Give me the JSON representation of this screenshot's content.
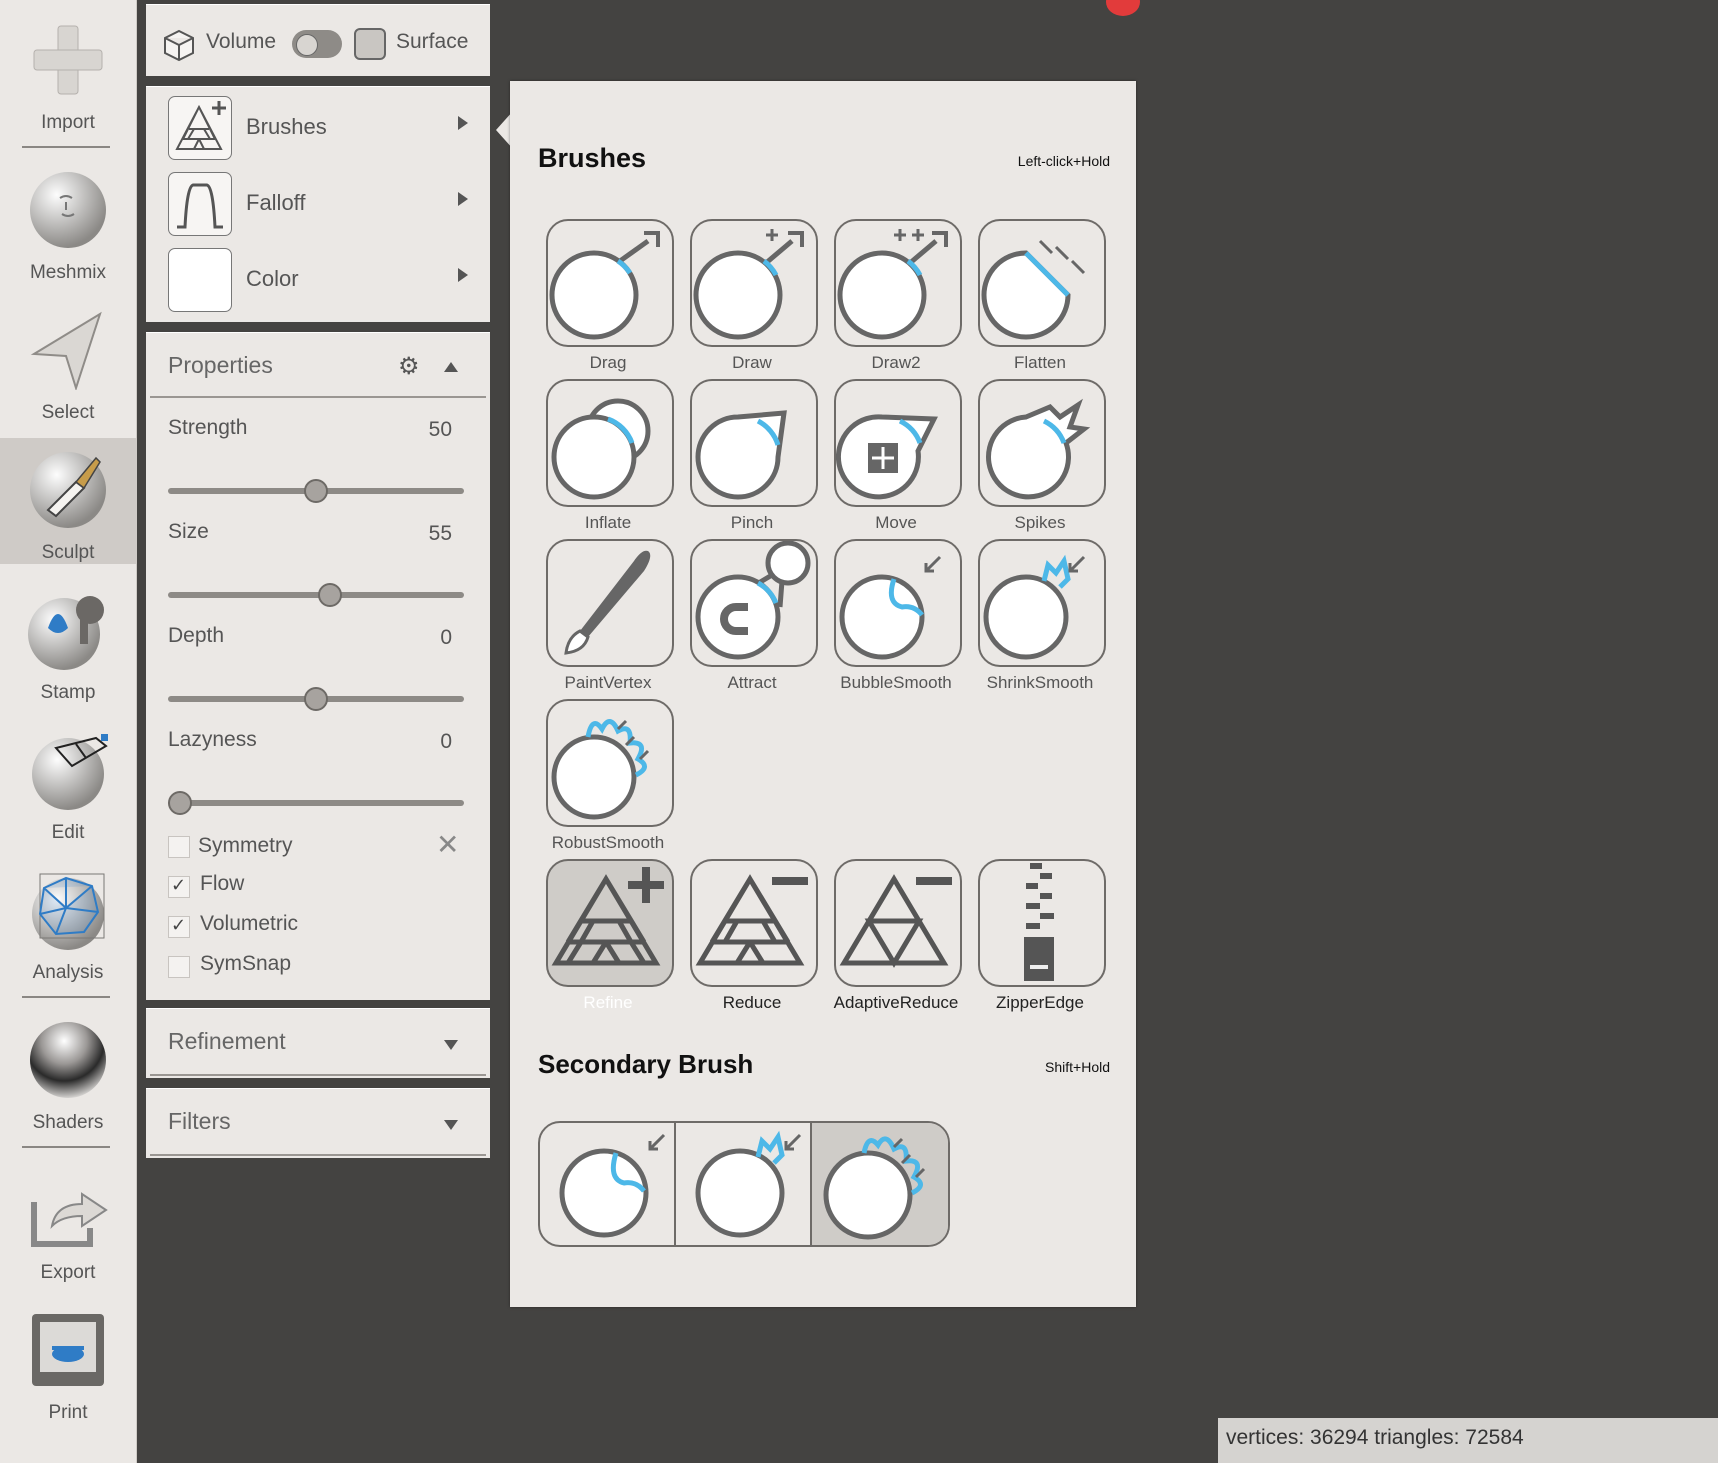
{
  "toolbar": {
    "items": [
      {
        "label": "Import",
        "icon": "plus-icon"
      },
      {
        "label": "Meshmix",
        "icon": "face-sphere-icon"
      },
      {
        "label": "Select",
        "icon": "cursor-arrow-icon"
      },
      {
        "label": "Sculpt",
        "icon": "brush-sphere-icon",
        "active": true
      },
      {
        "label": "Stamp",
        "icon": "stamp-sphere-icon"
      },
      {
        "label": "Edit",
        "icon": "edit-sphere-icon"
      },
      {
        "label": "Analysis",
        "icon": "mesh-sphere-icon"
      },
      {
        "label": "Shaders",
        "icon": "chrome-sphere-icon"
      },
      {
        "label": "Export",
        "icon": "export-arrow-icon"
      },
      {
        "label": "Print",
        "icon": "printer-icon"
      }
    ]
  },
  "mode": {
    "volume_label": "Volume",
    "surface_label": "Surface"
  },
  "tools_panel": {
    "brushes_label": "Brushes",
    "falloff_label": "Falloff",
    "color_label": "Color"
  },
  "properties": {
    "title": "Properties",
    "strength": {
      "label": "Strength",
      "value": "50",
      "fraction": 0.5
    },
    "size": {
      "label": "Size",
      "value": "55",
      "fraction": 0.55
    },
    "depth": {
      "label": "Depth",
      "value": "0",
      "fraction": 0.5
    },
    "lazyness": {
      "label": "Lazyness",
      "value": "0",
      "fraction": 0.0
    },
    "checkboxes": [
      {
        "label": "Symmetry",
        "checked": false
      },
      {
        "label": "Flow",
        "checked": true
      },
      {
        "label": "Volumetric",
        "checked": true
      },
      {
        "label": "SymSnap",
        "checked": false
      }
    ]
  },
  "refinement": {
    "title": "Refinement"
  },
  "filters": {
    "title": "Filters"
  },
  "popup": {
    "brushes_title": "Brushes",
    "brushes_hint": "Left-click+Hold",
    "brushes": [
      "Drag",
      "Draw",
      "Draw2",
      "Flatten",
      "Inflate",
      "Pinch",
      "Move",
      "Spikes",
      "PaintVertex",
      "Attract",
      "BubbleSmooth",
      "ShrinkSmooth",
      "RobustSmooth"
    ],
    "refine_brushes": [
      "Refine",
      "Reduce",
      "AdaptiveReduce",
      "ZipperEdge"
    ],
    "selected_refine": "Refine",
    "secondary_title": "Secondary Brush",
    "secondary_hint": "Shift+Hold"
  },
  "status": {
    "text": "vertices: 36294 triangles: 72584"
  },
  "colors": {
    "accent_blue": "#4db8e8",
    "panel_bg": "#ebe8e5",
    "viewport_bg": "#444341"
  }
}
